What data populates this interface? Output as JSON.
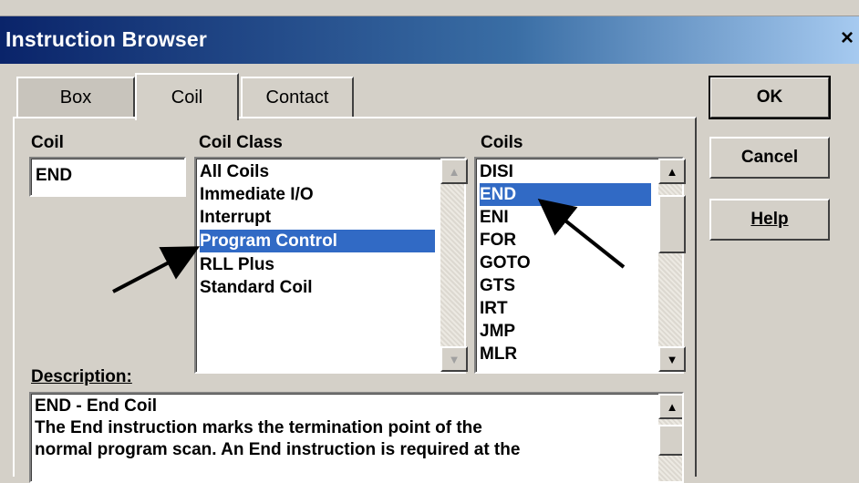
{
  "window": {
    "title": "Instruction Browser",
    "close_label": "×"
  },
  "tabs": [
    {
      "label": "Box",
      "active": false
    },
    {
      "label": "Coil",
      "active": true
    },
    {
      "label": "Contact",
      "active": false
    }
  ],
  "coil_field": {
    "label": "Coil",
    "value": "END"
  },
  "coil_class": {
    "label": "Coil Class",
    "items": [
      "All Coils",
      "Immediate I/O",
      "Interrupt",
      "Program Control",
      "RLL Plus",
      "Standard Coil"
    ],
    "selected": "Program Control"
  },
  "coils": {
    "label": "Coils",
    "items": [
      "DISI",
      "END",
      "ENI",
      "FOR",
      "GOTO",
      "GTS",
      "IRT",
      "JMP",
      "MLR"
    ],
    "selected": "END"
  },
  "description": {
    "label": "Description:",
    "lines": [
      "END - End Coil",
      "The End instruction marks the termination point of the",
      "normal program scan. An End instruction is required at the"
    ]
  },
  "buttons": {
    "ok": "OK",
    "cancel": "Cancel",
    "help": "Help"
  },
  "colors": {
    "selection": "#316ac5",
    "titlebar": "#0a246a",
    "dialog": "#d4d0c8"
  }
}
